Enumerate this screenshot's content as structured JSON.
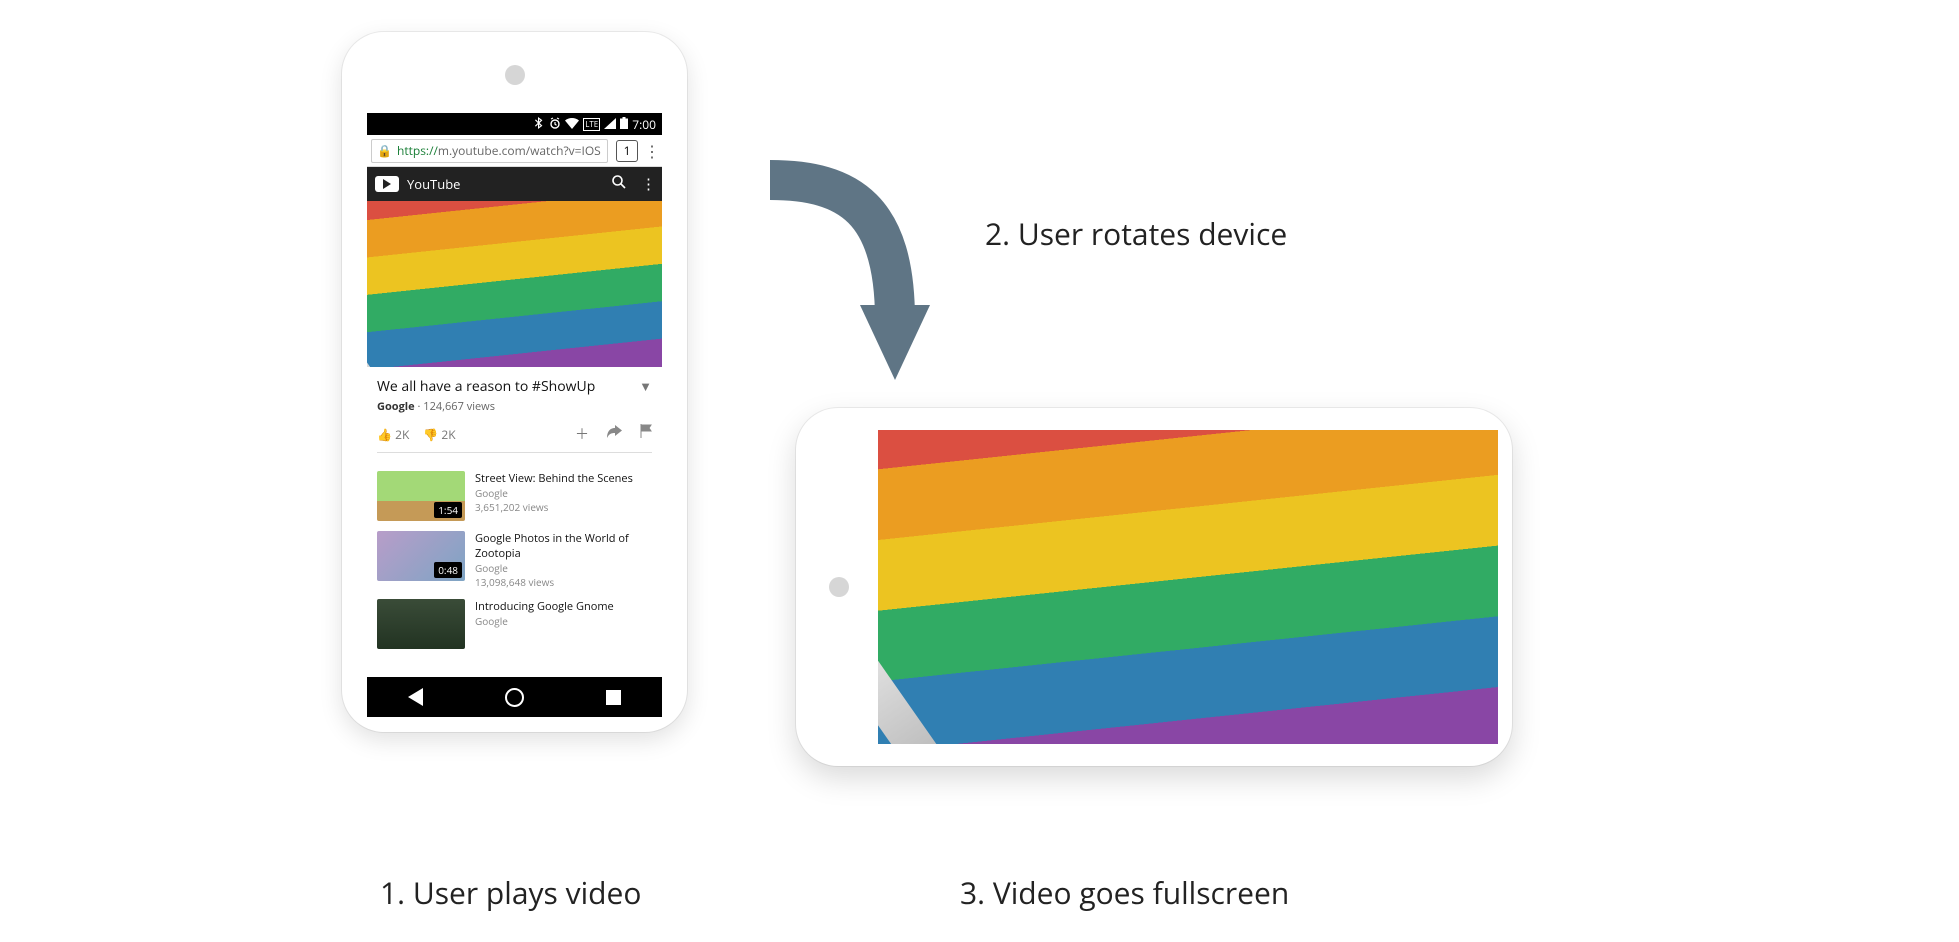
{
  "captions": {
    "step1": "1. User plays video",
    "step2": "2. User rotates device",
    "step3": "3. Video goes fullscreen"
  },
  "statusbar": {
    "icons": {
      "bluetooth": "bluetooth-icon",
      "alarm": "alarm-icon",
      "wifi": "wifi-icon",
      "lte": "LTE",
      "battery": "battery-icon"
    },
    "time": "7:00"
  },
  "browser": {
    "lock": "🔒",
    "url_https": "https://",
    "url_rest": "m.youtube.com/watch?v=IOS",
    "tab_count": "1",
    "menu": "⋮"
  },
  "youtube": {
    "brand": "YouTube",
    "search_icon": "search-icon",
    "menu_icon": "menu-icon"
  },
  "video": {
    "title": "We all have a reason to #ShowUp",
    "channel": "Google",
    "views_label": " · 124,667 views",
    "like_count": "2K",
    "dislike_count": "2K",
    "icons": {
      "like": "thumb-up-icon",
      "dislike": "thumb-down-icon",
      "add": "add-icon",
      "share": "share-icon",
      "flag": "flag-icon",
      "expand": "chevron-down-icon"
    }
  },
  "suggested": [
    {
      "title": "Street View: Behind the Scenes",
      "channel": "Google",
      "views": "3,651,202 views",
      "duration": "1:54"
    },
    {
      "title": "Google Photos in the World of Zootopia",
      "channel": "Google",
      "views": "13,098,648 views",
      "duration": "0:48"
    },
    {
      "title": "Introducing Google Gnome",
      "channel": "Google",
      "views": "",
      "duration": ""
    }
  ]
}
